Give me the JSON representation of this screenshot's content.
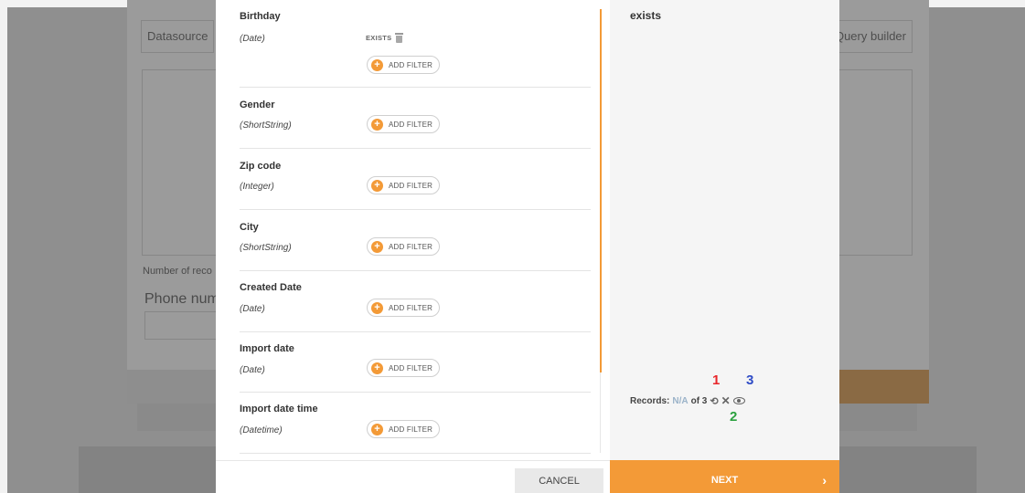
{
  "background": {
    "datasource_placeholder": "Datasource",
    "query_builder_label": "Query builder",
    "number_of_records_label": "Number of reco",
    "phone_number_label": "Phone numb"
  },
  "fields": [
    {
      "name": "Birthday",
      "type": "(Date)",
      "condition": "EXISTS",
      "add_filter": "ADD FILTER"
    },
    {
      "name": "Gender",
      "type": "(ShortString)",
      "add_filter": "ADD FILTER"
    },
    {
      "name": "Zip code",
      "type": "(Integer)",
      "add_filter": "ADD FILTER"
    },
    {
      "name": "City",
      "type": "(ShortString)",
      "add_filter": "ADD FILTER"
    },
    {
      "name": "Created Date",
      "type": "(Date)",
      "add_filter": "ADD FILTER"
    },
    {
      "name": "Import date",
      "type": "(Date)",
      "add_filter": "ADD FILTER"
    },
    {
      "name": "Import date time",
      "type": "(Datetime)",
      "add_filter": "ADD FILTER"
    }
  ],
  "preview": {
    "title": "exists",
    "records_label": "Records:",
    "records_value": "N/A",
    "records_total": "of 3",
    "annotations": {
      "one": "1",
      "two": "2",
      "three": "3"
    },
    "icons": [
      "refresh-icon",
      "shuffle-icon",
      "eye-icon"
    ]
  },
  "footer": {
    "cancel_label": "CANCEL",
    "next_label": "NEXT"
  },
  "colors": {
    "accent": "#f39a37",
    "annotation_1": "#e8272b",
    "annotation_2": "#2ba13f",
    "annotation_3": "#2f4cc6"
  }
}
